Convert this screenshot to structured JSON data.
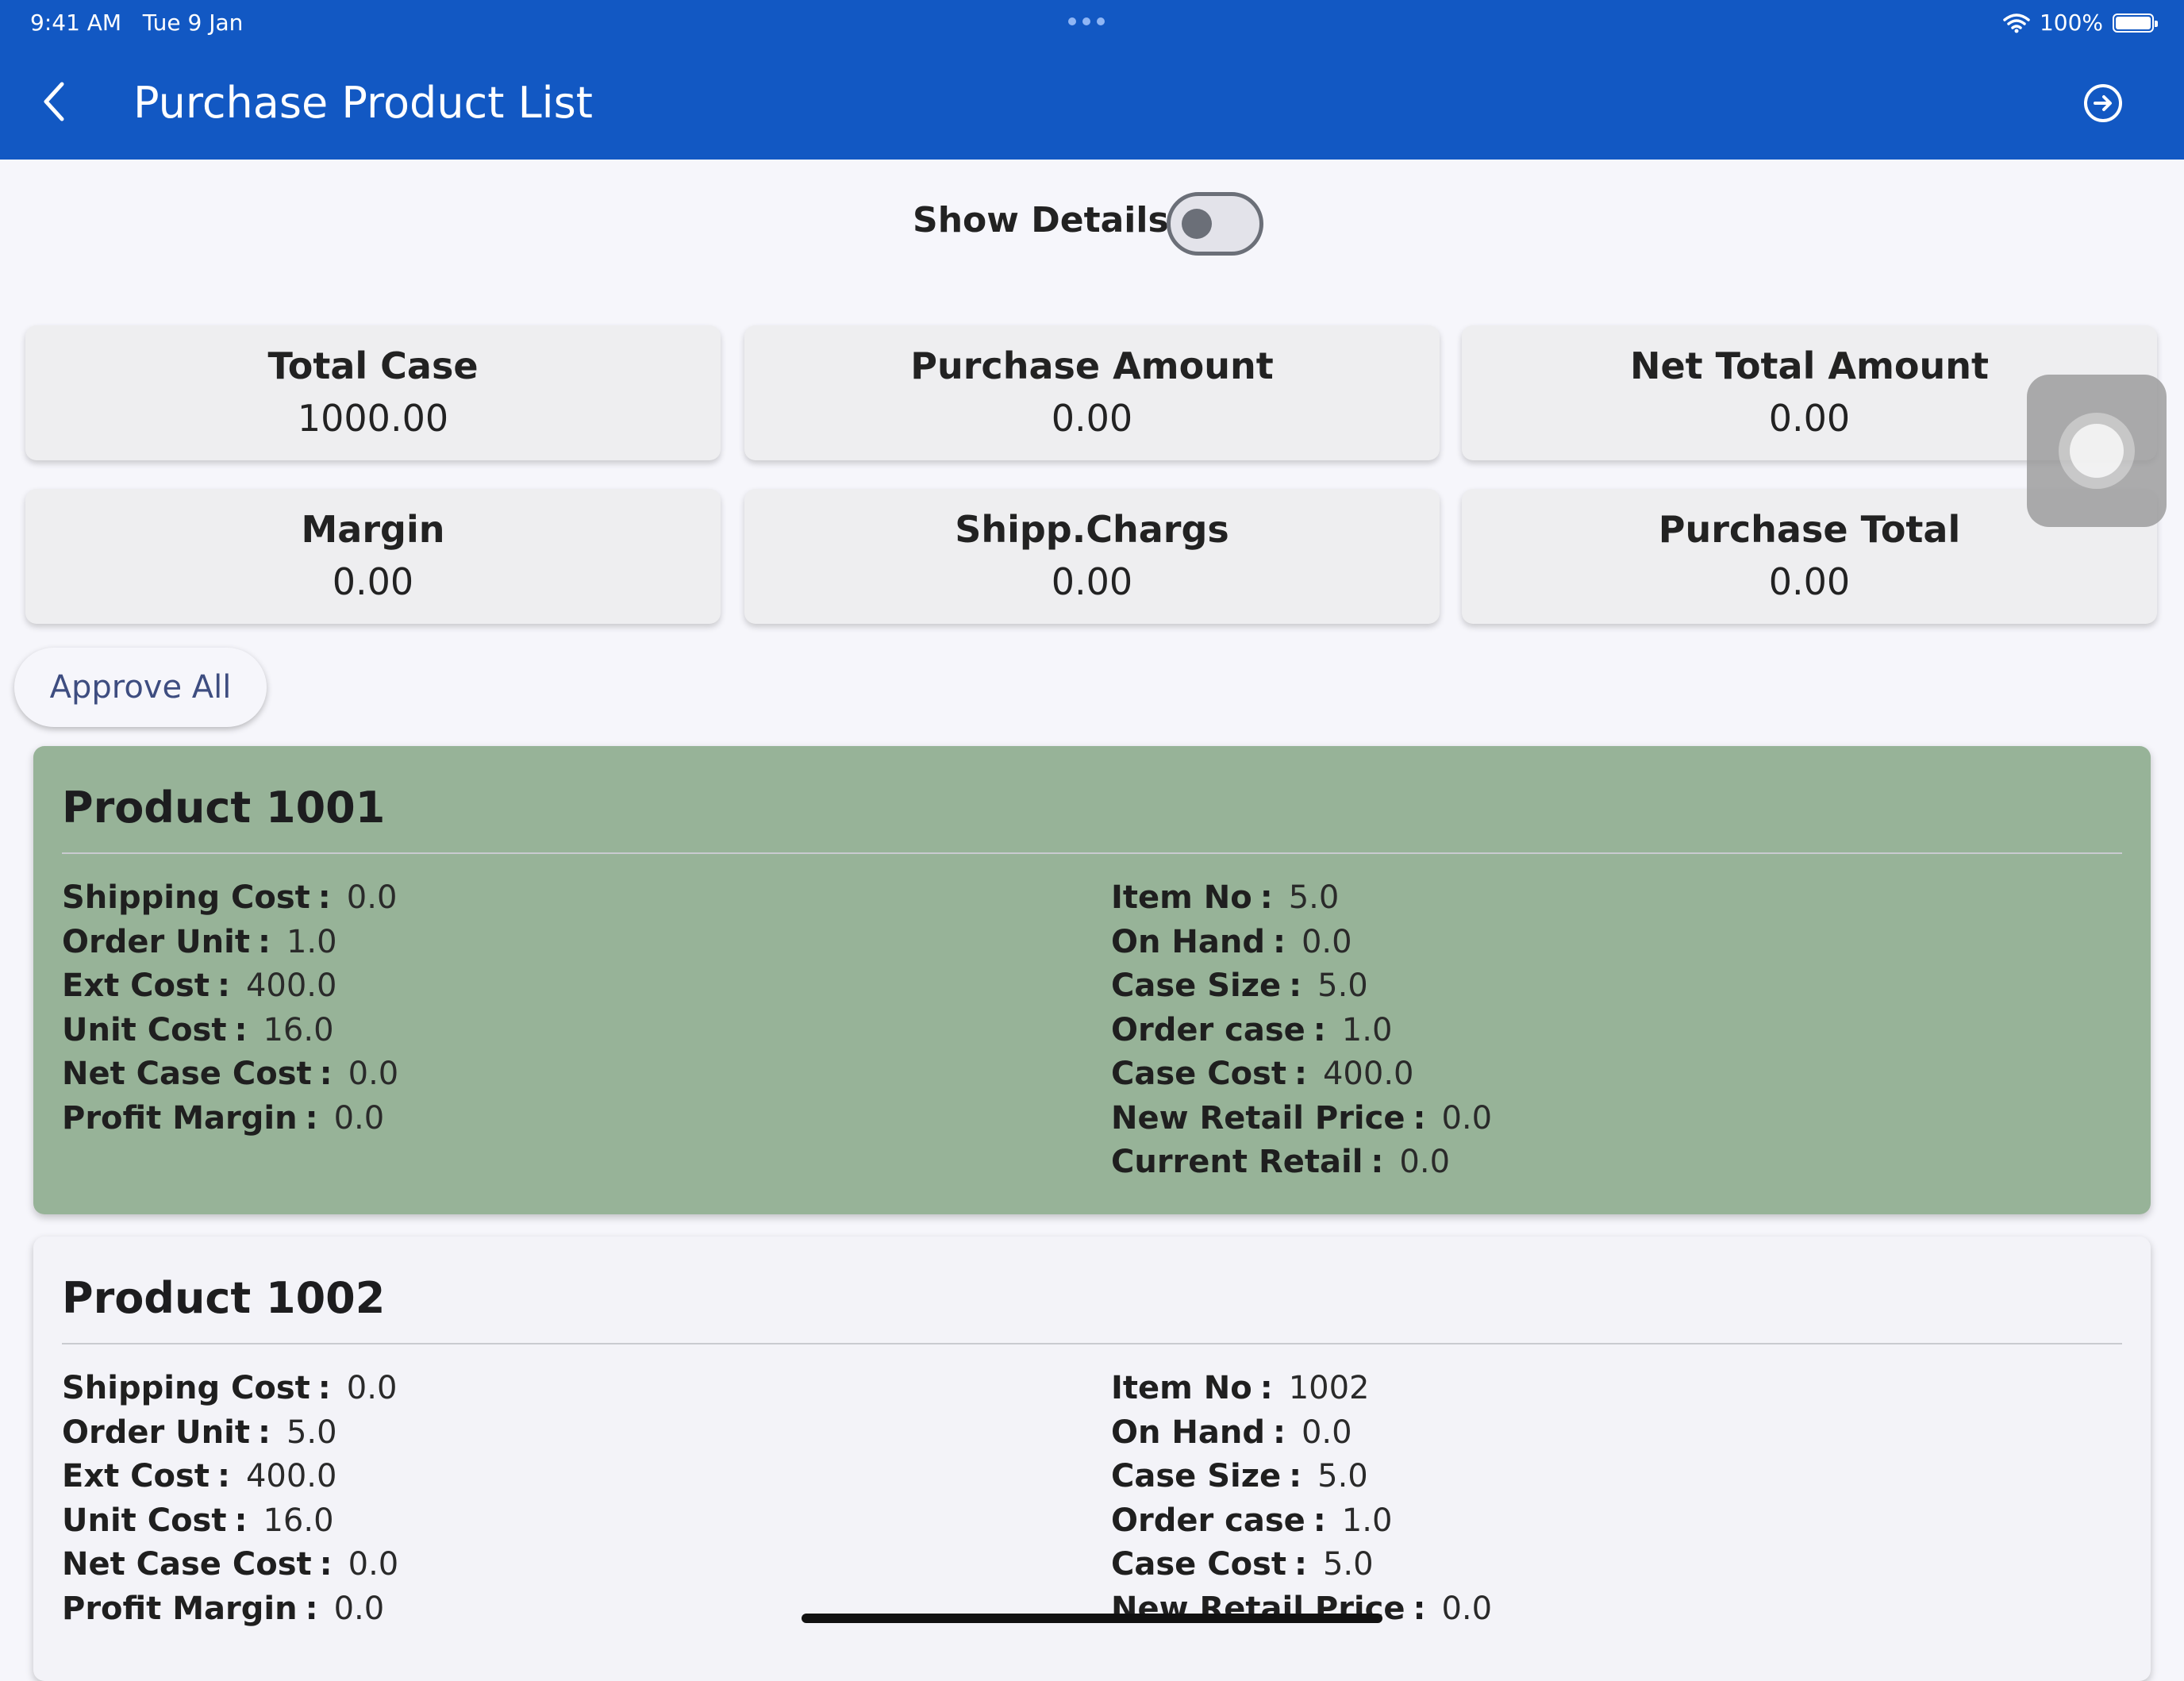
{
  "status_bar": {
    "time": "9:41 AM",
    "date": "Tue 9 Jan",
    "battery": "100%",
    "battery_level": 1.0
  },
  "header": {
    "title": "Purchase Product List"
  },
  "toggle": {
    "label": "Show Details :",
    "on": false
  },
  "summary": [
    {
      "title": "Total Case",
      "value": "1000.00"
    },
    {
      "title": "Purchase Amount",
      "value": "0.00"
    },
    {
      "title": "Net Total Amount",
      "value": "0.00"
    },
    {
      "title": "Margin",
      "value": "0.00"
    },
    {
      "title": "Shipp.Chargs",
      "value": "0.00"
    },
    {
      "title": "Purchase Total",
      "value": "0.00"
    }
  ],
  "approve_all": {
    "label": "Approve All"
  },
  "colors": {
    "appbar": "#1258C3",
    "approved_card": "#97B398",
    "pending_card": "#F3F3F8"
  },
  "products": [
    {
      "name": "Product 1001",
      "left": [
        {
          "label": "Shipping Cost",
          "value": "0.0"
        },
        {
          "label": "Order Unit",
          "value": "1.0"
        },
        {
          "label": "Ext Cost",
          "value": "400.0"
        },
        {
          "label": "Unit Cost",
          "value": "16.0"
        },
        {
          "label": "Net Case Cost",
          "value": "0.0"
        },
        {
          "label": "Profit Margin",
          "value": "0.0"
        }
      ],
      "right": [
        {
          "label": "Item No",
          "value": "5.0"
        },
        {
          "label": "On Hand",
          "value": "0.0"
        },
        {
          "label": "Case Size",
          "value": "5.0"
        },
        {
          "label": "Order case",
          "value": "1.0"
        },
        {
          "label": "Case Cost",
          "value": "400.0"
        },
        {
          "label": "New Retail Price",
          "value": "0.0"
        },
        {
          "label": "Current Retail",
          "value": "0.0"
        }
      ]
    },
    {
      "name": "Product 1002",
      "left": [
        {
          "label": "Shipping Cost",
          "value": "0.0"
        },
        {
          "label": "Order Unit",
          "value": "5.0"
        },
        {
          "label": "Ext Cost",
          "value": "400.0"
        },
        {
          "label": "Unit Cost",
          "value": "16.0"
        },
        {
          "label": "Net Case Cost",
          "value": "0.0"
        },
        {
          "label": "Profit Margin",
          "value": "0.0"
        }
      ],
      "right": [
        {
          "label": "Item No",
          "value": "1002"
        },
        {
          "label": "On Hand",
          "value": "0.0"
        },
        {
          "label": "Case Size",
          "value": "5.0"
        },
        {
          "label": "Order case",
          "value": "1.0"
        },
        {
          "label": "Case Cost",
          "value": "5.0"
        },
        {
          "label": "New Retail Price",
          "value": "0.0"
        }
      ]
    }
  ]
}
